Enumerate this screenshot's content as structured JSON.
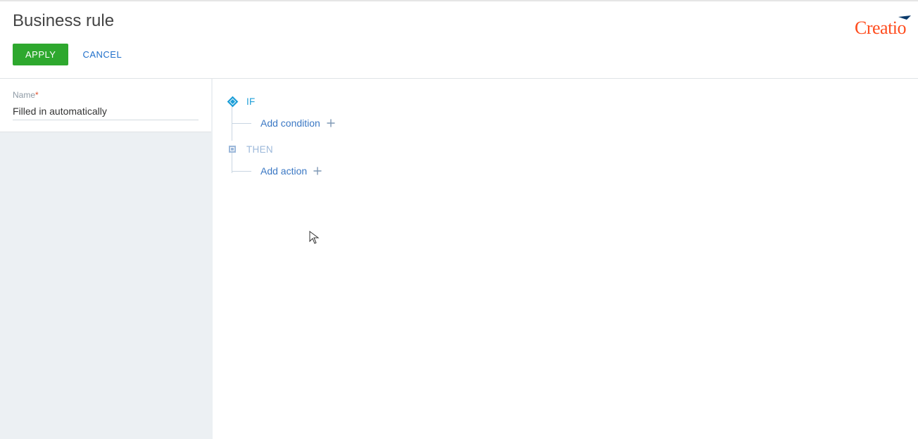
{
  "header": {
    "title": "Business rule",
    "apply_label": "APPLY",
    "cancel_label": "CANCEL",
    "logo_text": "Creatio"
  },
  "sidebar": {
    "name_label": "Name",
    "name_value": "Filled in automatically"
  },
  "rule": {
    "if_label": "IF",
    "then_label": "THEN",
    "add_condition_label": "Add condition",
    "add_action_label": "Add action"
  }
}
